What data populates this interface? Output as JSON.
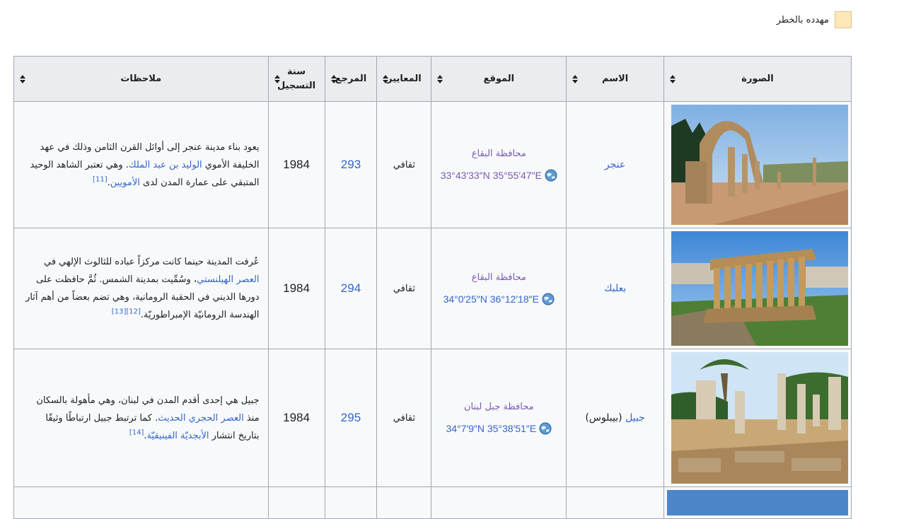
{
  "legend": {
    "label": "مهدده بالخطر",
    "color": "#ffe8b8"
  },
  "table": {
    "headers": {
      "image": "الصورة",
      "name": "الاسم",
      "location": "الموقع",
      "criteria": "المعايير",
      "reference": "المرجع",
      "year": "سنة التسجيل",
      "notes": "ملاحظات"
    },
    "rows": [
      {
        "name": "عنجر",
        "name_suffix": "",
        "governorate": "محافظة البقاع",
        "coords": "33°43′33″N 35°55′47″E",
        "criteria": "ثقافي",
        "reference": "293",
        "year": "1984",
        "notes": {
          "p1": "يعود بناء مدينة عنجر إلى أوائل القرن الثامن وذلك في عهد الخليفة الأموي ",
          "l1": "الوليد بن عبد الملك",
          "p2": ". وهي تعتبر الشاهد الوحيد المتبقي على عمارة المدن لدى ",
          "l2": "الأمويين",
          "p3": ".",
          "refs": "[11]"
        }
      },
      {
        "name": "بعلبك",
        "name_suffix": "",
        "governorate": "محافظة البقاع",
        "coords": "34°0′25″N 36°12′18″E",
        "criteria": "ثقافي",
        "reference": "294",
        "year": "1984",
        "notes": {
          "p1": "عُرفت المدينة حينما كانت مركزاً عباده للثالوث الإلهي في ",
          "l1": "العصر الهيلنستي",
          "p2": "، وسُمِّيت بمدينة الشمس. ثُمَّ حافظت على دورها الديني في الحقبة الرومانية، وهي تضم بعضاً من أهم آثار الهندسة الرومانيّة الإمبراطوريّة.",
          "l2": "",
          "p3": "",
          "refs": "[12][13]"
        }
      },
      {
        "name": "جبيل",
        "name_suffix": " (بيبلوس)",
        "governorate": "محافظة جبل لبنان",
        "coords": "34°7′9″N 35°38′51″E",
        "criteria": "ثقافي",
        "reference": "295",
        "year": "1984",
        "notes": {
          "p1": "جبيل هي إحدى أقدم المدن في لبنان، وهي مأهولة بالسكان منذ ",
          "l1": "العصر الحجري الحديث",
          "p2": ". كما ترتبط جبيل ارتباطًا وثيقًا بتاريخ انتشار ",
          "l2": "الأبجديّة الفينيقيّة",
          "p3": ".",
          "refs": "[14]"
        }
      }
    ]
  }
}
